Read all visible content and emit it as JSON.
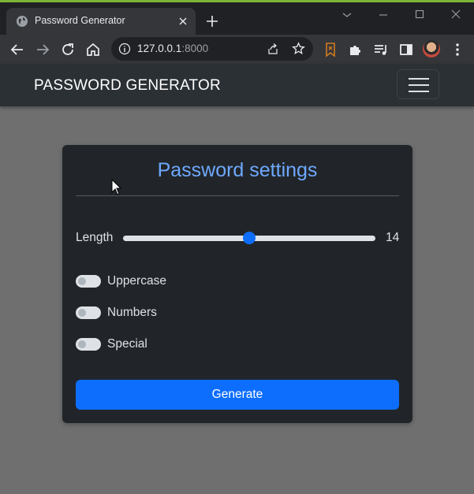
{
  "browser": {
    "tab_title": "Password Generator",
    "url_host": "127.0.0.1",
    "url_port": ":8000",
    "icons": [
      "globe-icon",
      "close-icon",
      "plus-icon",
      "chevron-down-icon",
      "minimize-icon",
      "maximize-icon",
      "window-close-icon",
      "back-arrow-icon",
      "forward-arrow-icon",
      "reload-icon",
      "home-icon",
      "info-icon",
      "share-icon",
      "star-icon",
      "bookmark-extension-icon",
      "puzzle-icon",
      "media-icon",
      "sidepanel-icon",
      "avatar",
      "kebab-menu-icon"
    ]
  },
  "navbar": {
    "brand": "PASSWORD GENERATOR",
    "toggler_icon": "hamburger-icon"
  },
  "settings": {
    "title": "Password settings",
    "length_label": "Length",
    "length_value": "14",
    "length_fraction": 0.5,
    "options": [
      {
        "label": "Uppercase",
        "checked": false
      },
      {
        "label": "Numbers",
        "checked": false
      },
      {
        "label": "Special",
        "checked": false
      }
    ],
    "generate_label": "Generate"
  },
  "colors": {
    "accent": "#0d6efd",
    "title": "#6ea8fe",
    "card": "#212529",
    "navbar": "#2b3035",
    "backdrop": "#6f6f6f"
  }
}
